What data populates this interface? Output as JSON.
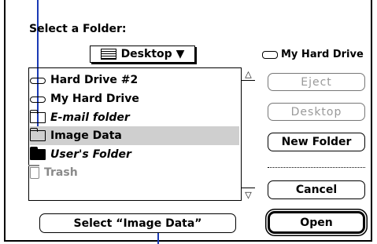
{
  "dialog": {
    "title": "Select a Folder:",
    "location_popup": "Desktop",
    "location_arrow": "▼",
    "current_volume": "My Hard Drive"
  },
  "file_list": [
    {
      "label": "Hard Drive #2",
      "icon": "drive-icon",
      "style": "normal",
      "selected": false
    },
    {
      "label": "My Hard Drive",
      "icon": "drive-icon",
      "style": "normal",
      "selected": false
    },
    {
      "label": "E-mail folder",
      "icon": "folder-icon",
      "style": "italic",
      "selected": false
    },
    {
      "label": "Image Data",
      "icon": "folder-icon",
      "style": "normal",
      "selected": true
    },
    {
      "label": "User's Folder",
      "icon": "shared-folder-icon",
      "style": "italic",
      "selected": false
    },
    {
      "label": "Trash",
      "icon": "trash-icon",
      "style": "disabled",
      "selected": false
    }
  ],
  "buttons": {
    "eject": "Eject",
    "desktop": "Desktop",
    "new_folder": "New Folder",
    "cancel": "Cancel",
    "open": "Open",
    "select": "Select “Image Data”"
  }
}
